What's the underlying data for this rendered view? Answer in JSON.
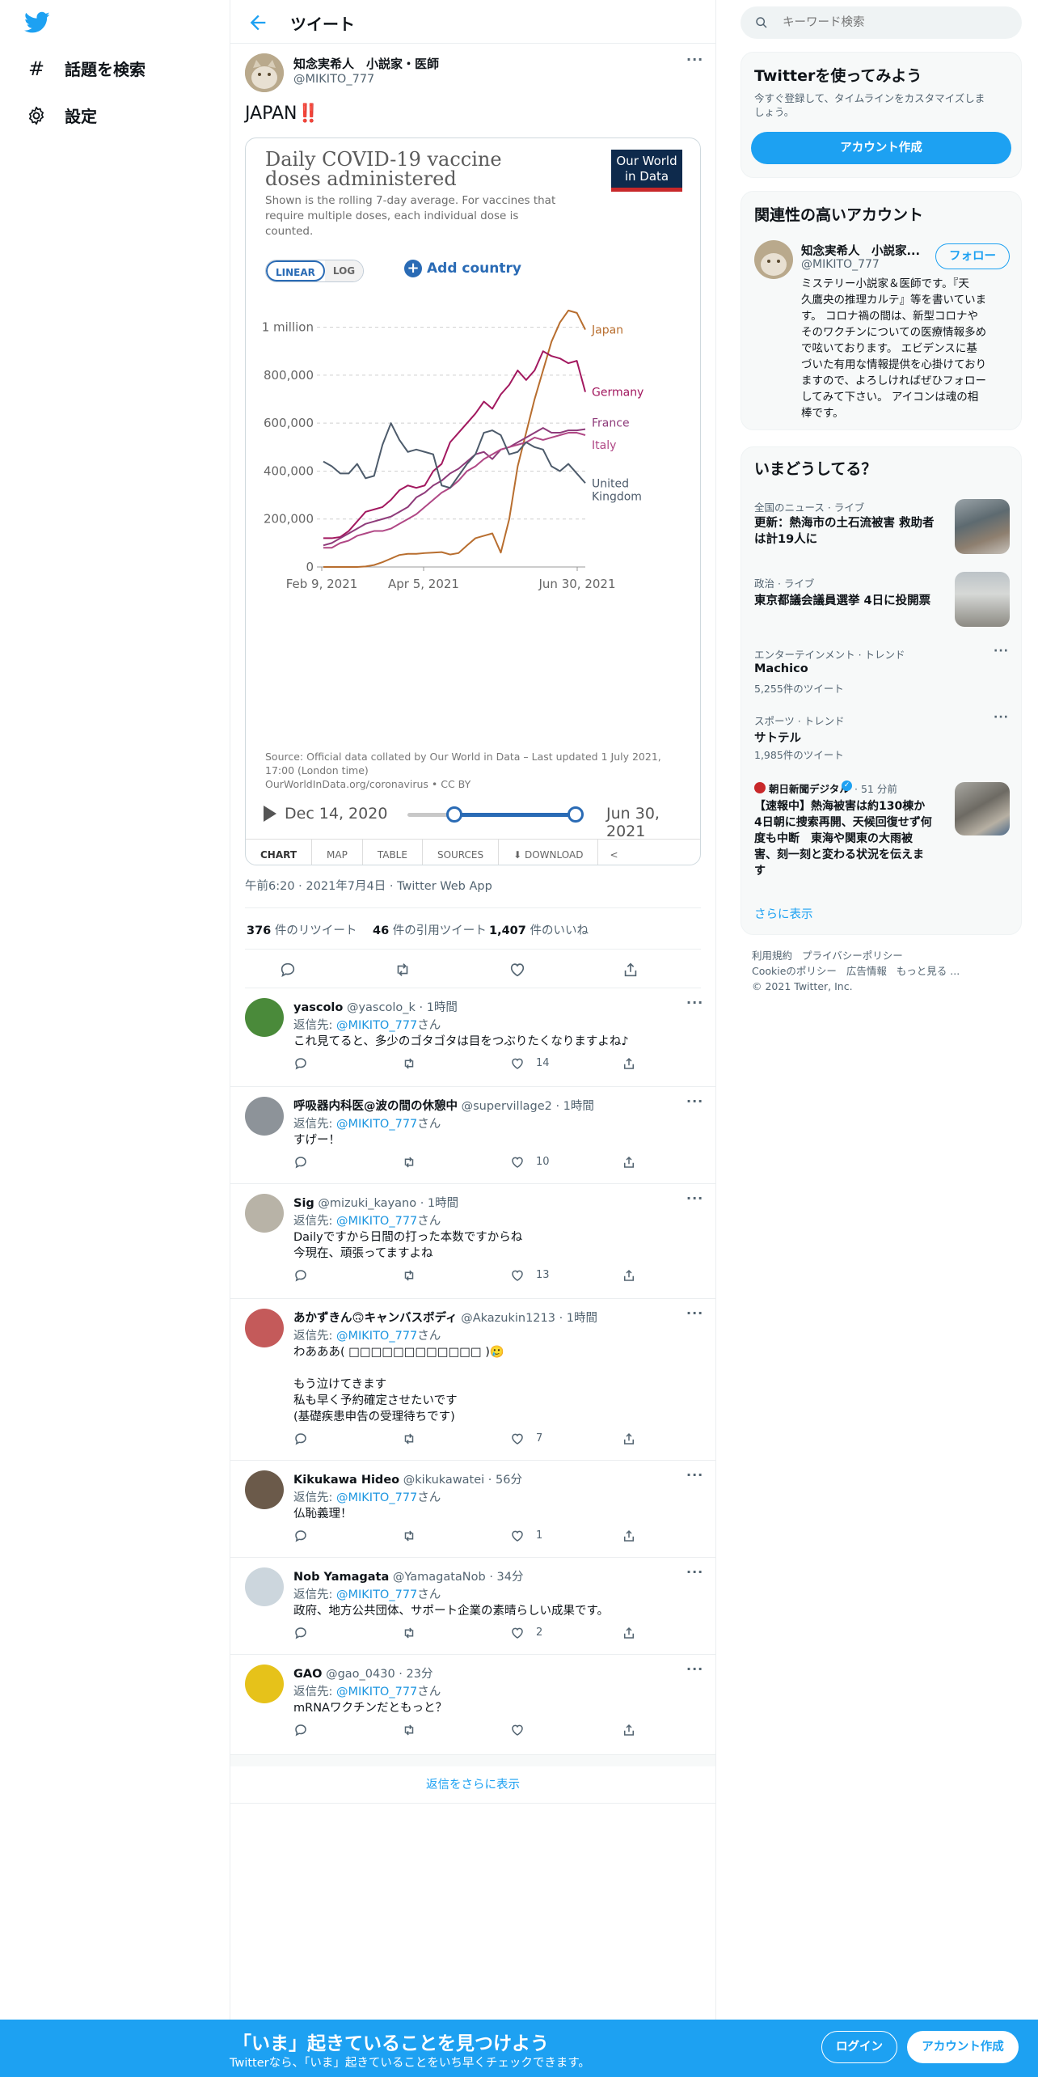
{
  "header": {
    "title": "ツイート"
  },
  "nav": {
    "explore": "話題を検索",
    "settings": "設定"
  },
  "tweet": {
    "author_name": "知念実希人　小説家・医師",
    "handle": "@MIKITO_777",
    "text": "JAPAN‼️",
    "timestamp": "午前6:20 · 2021年7月4日 · Twitter Web App",
    "stats": {
      "retweets_count": "376",
      "retweets_label": "件のリツイート",
      "quotes_count": "46",
      "quotes_label": "件の引用ツイート",
      "likes_count": "1,407",
      "likes_label": "件のいいね"
    }
  },
  "chart_card": {
    "logo_line1": "Our World",
    "logo_line2": "in Data",
    "toggle_linear": "LINEAR",
    "toggle_log": "LOG",
    "add_country": "Add country",
    "source_line1": "Source: Official data collated by Our World in Data – Last updated 1 July 2021,",
    "source_line2": "17:00 (London time)",
    "source_line3": "OurWorldInData.org/coronavirus • CC BY",
    "play_start": "Dec 14, 2020",
    "play_end": "Jun 30, 2021",
    "tabs": [
      "CHART",
      "MAP",
      "TABLE",
      "SOURCES",
      "DOWNLOAD"
    ]
  },
  "chart_data": {
    "type": "line",
    "title": "Daily COVID-19 vaccine doses administered",
    "subtitle_lines": [
      "Shown is the rolling 7-day average. For vaccines that",
      "require multiple doses, each individual dose is",
      "counted."
    ],
    "x_start": "Feb 9, 2021",
    "x_end": "Jun 30, 2021",
    "x_ticks": [
      "Feb 9, 2021",
      "Apr 5, 2021",
      "Jun 30, 2021"
    ],
    "y_ticks": [
      "0",
      "200,000",
      "400,000",
      "600,000",
      "800,000",
      "1 million"
    ],
    "ylim": [
      0,
      1100000
    ],
    "grid": true,
    "series": [
      {
        "name": "Japan",
        "color": "#b86e2f",
        "values": [
          0,
          0,
          0,
          0,
          0,
          2000,
          8000,
          20000,
          35000,
          50000,
          55000,
          55000,
          58000,
          60000,
          62000,
          52000,
          58000,
          90000,
          120000,
          130000,
          140000,
          60000,
          200000,
          420000,
          560000,
          700000,
          820000,
          940000,
          1020000,
          1070000,
          1060000,
          990000
        ]
      },
      {
        "name": "Germany",
        "color": "#a2185f",
        "values": [
          120000,
          120000,
          125000,
          150000,
          190000,
          230000,
          240000,
          250000,
          280000,
          320000,
          340000,
          330000,
          340000,
          400000,
          430000,
          520000,
          560000,
          600000,
          640000,
          690000,
          660000,
          720000,
          760000,
          820000,
          780000,
          820000,
          900000,
          880000,
          870000,
          850000,
          860000,
          730000
        ]
      },
      {
        "name": "France",
        "color": "#8e3b7a",
        "values": [
          90000,
          100000,
          120000,
          140000,
          160000,
          180000,
          190000,
          200000,
          210000,
          230000,
          250000,
          290000,
          310000,
          340000,
          360000,
          390000,
          410000,
          440000,
          470000,
          480000,
          450000,
          490000,
          500000,
          520000,
          540000,
          560000,
          580000,
          560000,
          560000,
          570000,
          570000,
          575000
        ]
      },
      {
        "name": "Italy",
        "color": "#b04785",
        "values": [
          80000,
          80000,
          100000,
          110000,
          130000,
          140000,
          150000,
          150000,
          160000,
          180000,
          200000,
          220000,
          250000,
          280000,
          310000,
          330000,
          360000,
          400000,
          420000,
          450000,
          470000,
          490000,
          500000,
          510000,
          520000,
          540000,
          530000,
          540000,
          550000,
          560000,
          560000,
          550000
        ]
      },
      {
        "name": "United Kingdom",
        "color": "#4d5b6b",
        "values": [
          440000,
          420000,
          390000,
          390000,
          430000,
          370000,
          380000,
          510000,
          600000,
          530000,
          480000,
          490000,
          480000,
          470000,
          340000,
          330000,
          380000,
          430000,
          470000,
          560000,
          570000,
          550000,
          470000,
          480000,
          520000,
          500000,
          490000,
          420000,
          400000,
          430000,
          390000,
          350000
        ]
      }
    ]
  },
  "replies": [
    {
      "name": "yascolo",
      "handle": "@yascolo_k · 1時間",
      "reply_to_prefix": "返信先:",
      "reply_to_handle": "@MIKITO_777",
      "reply_to_suffix": "さん",
      "text": "これ見てると、多少のゴタゴタは目をつぶりたくなりますよね♪",
      "likes": "14",
      "avatar_color": "#4a8a3a"
    },
    {
      "name": "呼吸器内科医@波の間の休憩中",
      "handle": "@supervillage2 · 1時間",
      "reply_to_prefix": "返信先:",
      "reply_to_handle": "@MIKITO_777",
      "reply_to_suffix": "さん",
      "text": "すげー！",
      "likes": "10",
      "avatar_color": "#8d9399"
    },
    {
      "name": "Sig",
      "handle": "@mizuki_kayano · 1時間",
      "reply_to_prefix": "返信先:",
      "reply_to_handle": "@MIKITO_777",
      "reply_to_suffix": "さん",
      "text": "Dailyですから日間の打った本数ですからね\n今現在、頑張ってますよね",
      "likes": "13",
      "avatar_color": "#b8b3a7"
    },
    {
      "name": "あかずきん🙃キャンバスボディ",
      "handle": "@Akazukin1213 · 1時間",
      "reply_to_prefix": "返信先:",
      "reply_to_handle": "@MIKITO_777",
      "reply_to_suffix": "さん",
      "text": "わあああ( □□□□□□□□□□□□ )🥲\n\nもう泣けてきます\n私も早く予約確定させたいです\n(基礎疾患申告の受理待ちです)",
      "likes": "7",
      "avatar_color": "#c45a5a"
    },
    {
      "name": "Kikukawa Hideo",
      "handle": "@kikukawatei · 56分",
      "reply_to_prefix": "返信先:",
      "reply_to_handle": "@MIKITO_777",
      "reply_to_suffix": "さん",
      "text": "仏恥義理！",
      "likes": "1",
      "avatar_color": "#6b5a4a"
    },
    {
      "name": "Nob Yamagata",
      "handle": "@YamagataNob · 34分",
      "reply_to_prefix": "返信先:",
      "reply_to_handle": "@MIKITO_777",
      "reply_to_suffix": "さん",
      "text": "政府、地方公共団体、サポート企業の素晴らしい成果です。",
      "likes": "2",
      "avatar_color": "#ccd6dd"
    },
    {
      "name": "GAO",
      "handle": "@gao_0430 · 23分",
      "reply_to_prefix": "返信先:",
      "reply_to_handle": "@MIKITO_777",
      "reply_to_suffix": "さん",
      "text": "mRNAワクチンだともっと？",
      "likes": "",
      "avatar_color": "#e6c21a"
    }
  ],
  "show_more_replies": "返信をさらに表示",
  "search": {
    "placeholder": "キーワード検索"
  },
  "signup_panel": {
    "title": "Twitterを使ってみよう",
    "text_line1": "今すぐ登録して、タイムラインをカスタマイズしま",
    "text_line2": "しょう。",
    "button": "アカウント作成"
  },
  "relevant": {
    "title": "関連性の高いアカウント",
    "name": "知念実希人　小説家...",
    "handle": "@MIKITO_777",
    "follow": "フォロー",
    "bio_lines": [
      "ミステリー小説家＆医師です。『天",
      "久鷹央の推理カルテ』等を書いていま",
      "す。 コロナ禍の間は、新型コロナや",
      "そのワクチンについての医療情報多め",
      "で呟いております。 エビデンスに基",
      "づいた有用な情報提供を心掛けており",
      "ますので、よろしければぜひフォロー",
      "してみて下さい。 アイコンは魂の相",
      "棒です。"
    ]
  },
  "trends": {
    "title": "いまどうしてる？",
    "show_more": "さらに表示",
    "items": [
      {
        "context": "全国のニュース · ライブ",
        "title_line1": "更新：熱海市の土石流被害 救助者",
        "title_line2": "は計19人に",
        "count": ""
      },
      {
        "context": "政治 · ライブ",
        "title_line1": "東京都議会議員選挙 4日に投開票",
        "title_line2": "",
        "count": ""
      },
      {
        "context": "エンターテインメント · トレンド",
        "title_line1": "Machico",
        "title_line2": "",
        "count": "5,255件のツイート"
      },
      {
        "context": "スポーツ · トレンド",
        "title_line1": "サトテル",
        "title_line2": "",
        "count": "1,985件のツイート"
      }
    ],
    "news": {
      "source": "朝日新聞デジタル",
      "time": "· 51 分前",
      "lines": [
        "【速報中】熱海被害は約130棟か",
        "4日朝に捜索再開、天候回復せず何",
        "度も中断　東海や関東の大雨被",
        "害、刻一刻と変わる状況を伝えま",
        "す"
      ]
    }
  },
  "footer": {
    "line1": [
      "利用規約",
      "プライバシーポリシー"
    ],
    "line2": [
      "Cookieのポリシー",
      "広告情報",
      "もっと見る ..."
    ],
    "copyright": "© 2021 Twitter, Inc."
  },
  "bottom_bar": {
    "headline": "「いま」起きていることを見つけよう",
    "sub": "Twitterなら、「いま」起きていることをいち早くチェックできます。",
    "login": "ログイン",
    "signup": "アカウント作成"
  },
  "colors": {
    "accent": "#1da1f2",
    "link": "#1b95e0",
    "text": "#0f1419",
    "muted": "#536471"
  }
}
